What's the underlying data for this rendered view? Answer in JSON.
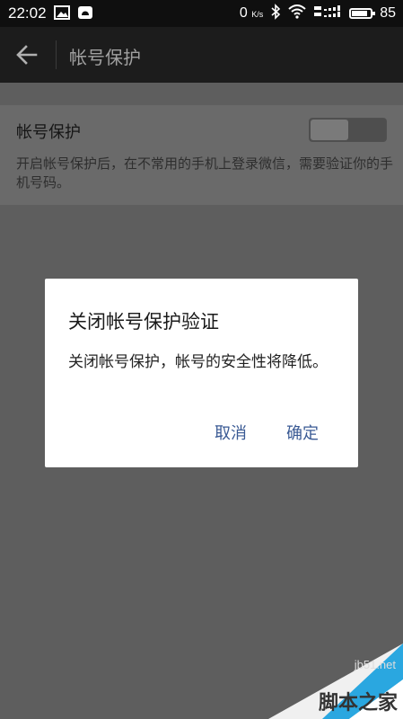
{
  "status_bar": {
    "time": "22:02",
    "net_speed_value": "0",
    "net_speed_unit": "K/s",
    "battery": "85",
    "battery_level": 0.85
  },
  "app_bar": {
    "title": "帐号保护",
    "back_icon": "arrow-left-icon"
  },
  "setting": {
    "title": "帐号保护",
    "description": "开启帐号保护后，在不常用的手机上登录微信，需要验证你的手机号码。",
    "toggle_on": true
  },
  "dialog": {
    "title": "关闭帐号保护验证",
    "message": "关闭帐号保护，帐号的安全性将降低。",
    "cancel_label": "取消",
    "confirm_label": "确定",
    "button_color": "#3a5a94"
  },
  "watermark": {
    "url": "jb51.net",
    "name": "脚本之家"
  }
}
